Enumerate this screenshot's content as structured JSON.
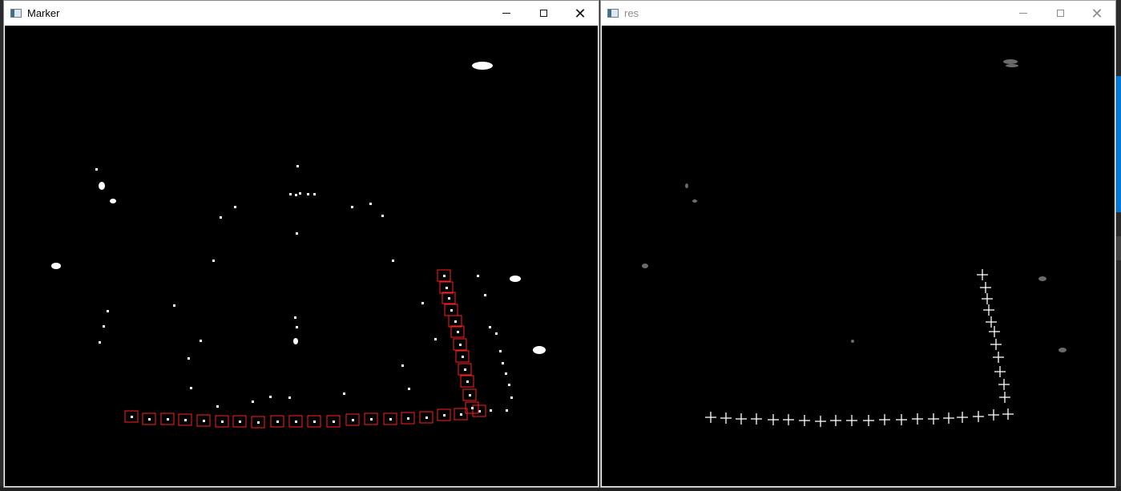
{
  "windows": [
    {
      "title": "Marker"
    },
    {
      "title": "res"
    }
  ],
  "controls": {
    "minimize": "minimize",
    "maximize": "maximize",
    "close": "close"
  },
  "colors": {
    "marker_box": "#ff2020",
    "blob": "#ffffff",
    "cross": "#ffffff",
    "background": "#000000"
  }
}
